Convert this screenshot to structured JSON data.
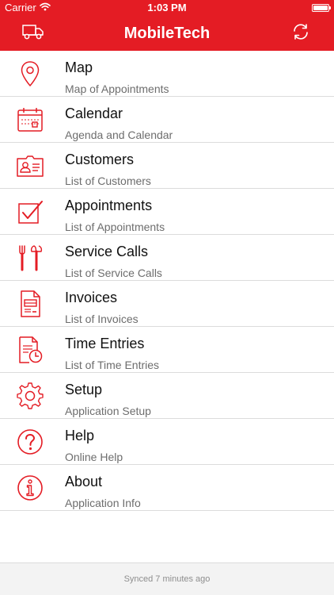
{
  "status_bar": {
    "carrier": "Carrier",
    "time": "1:03 PM"
  },
  "nav": {
    "title": "MobileTech",
    "left_icon": "truck-icon",
    "right_icon": "sync-icon"
  },
  "accent_color": "#e41c24",
  "menu": [
    {
      "title": "Map",
      "subtitle": "Map of Appointments",
      "icon": "map-pin-icon"
    },
    {
      "title": "Calendar",
      "subtitle": "Agenda and Calendar",
      "icon": "calendar-icon"
    },
    {
      "title": "Customers",
      "subtitle": "List of Customers",
      "icon": "customer-card-icon"
    },
    {
      "title": "Appointments",
      "subtitle": "List of Appointments",
      "icon": "checkbox-icon"
    },
    {
      "title": "Service Calls",
      "subtitle": "List of Service Calls",
      "icon": "tools-icon"
    },
    {
      "title": "Invoices",
      "subtitle": "List of Invoices",
      "icon": "invoice-icon"
    },
    {
      "title": "Time Entries",
      "subtitle": "List of Time Entries",
      "icon": "timesheet-icon"
    },
    {
      "title": "Setup",
      "subtitle": "Application Setup",
      "icon": "gear-icon"
    },
    {
      "title": "Help",
      "subtitle": "Online Help",
      "icon": "help-icon"
    },
    {
      "title": "About",
      "subtitle": "Application Info",
      "icon": "info-icon"
    }
  ],
  "footer": {
    "sync_status": "Synced 7 minutes ago"
  }
}
